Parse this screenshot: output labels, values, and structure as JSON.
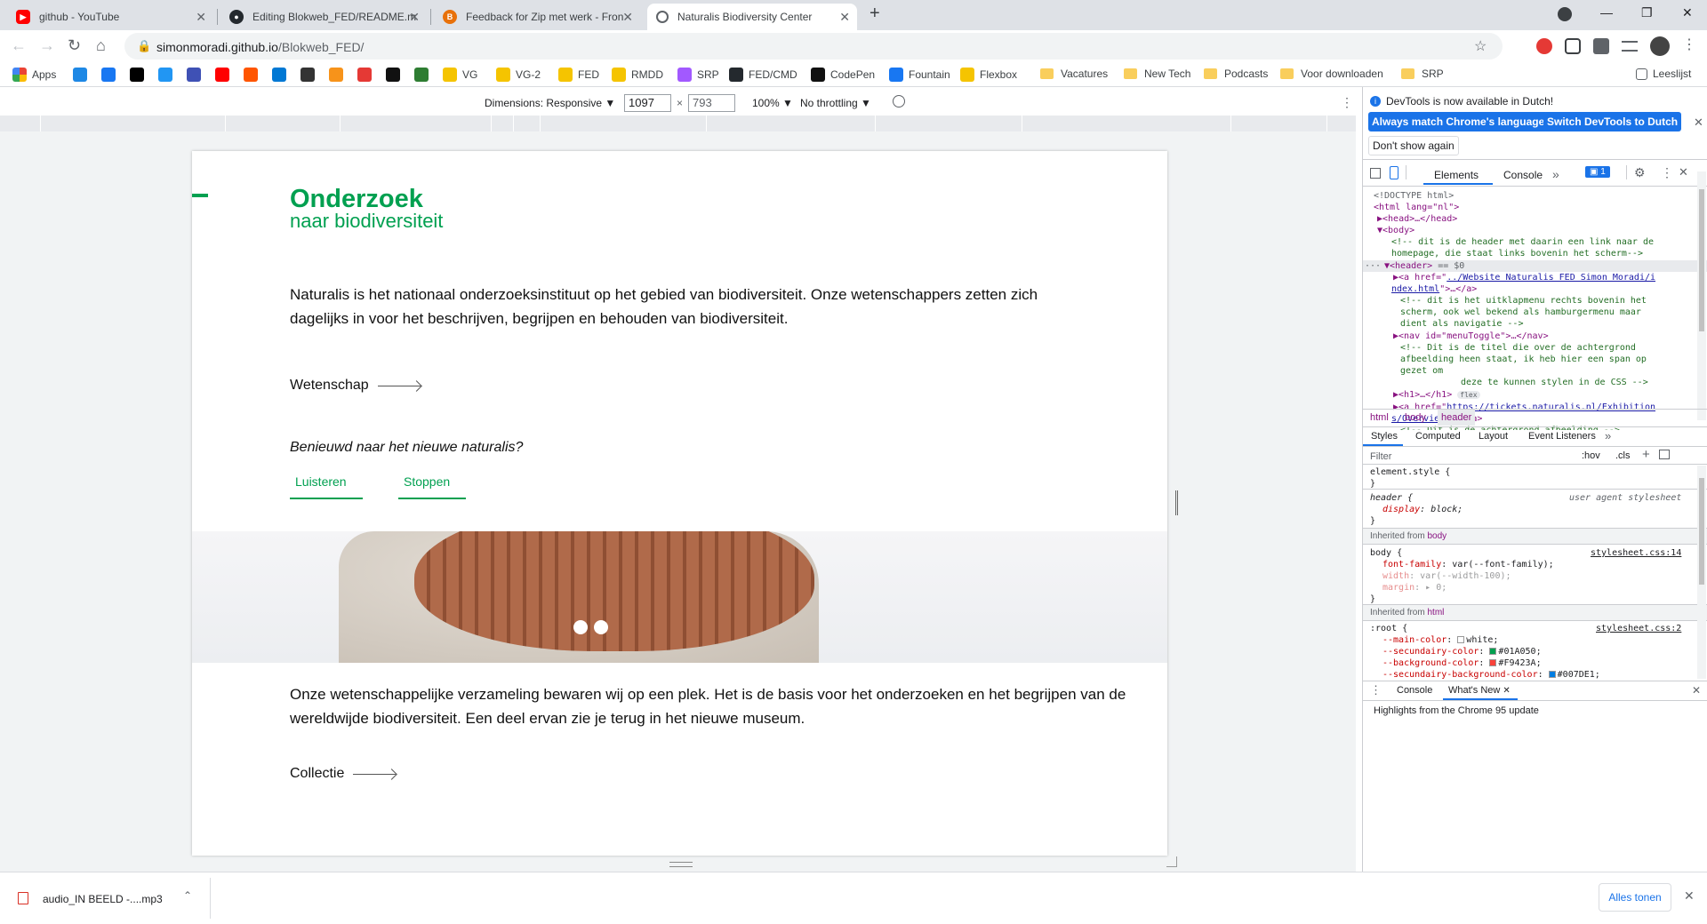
{
  "browser": {
    "tabs": [
      {
        "title": "github - YouTube",
        "icon": "youtube-icon",
        "color": "#ff0000"
      },
      {
        "title": "Editing Blokweb_FED/README.m",
        "icon": "github-icon",
        "color": "#24292e"
      },
      {
        "title": "Feedback for Zip met werk - Fron",
        "icon": "feedback-icon",
        "color": "#e8710a"
      },
      {
        "title": "Naturalis Biodiversity Center",
        "icon": "globe-icon",
        "color": "#5f6368"
      }
    ],
    "new_tab": "+",
    "url_host": "simonmoradi.github.io",
    "url_path": "/Blokweb_FED/",
    "bookmarks": [
      {
        "label": "Apps",
        "type": "apps"
      },
      {
        "label": "",
        "type": "icon",
        "color": "#1e88e5"
      },
      {
        "label": "",
        "type": "icon",
        "color": "#1877f2"
      },
      {
        "label": "",
        "type": "icon",
        "color": "#000000"
      },
      {
        "label": "",
        "type": "icon",
        "color": "#2196f3"
      },
      {
        "label": "",
        "type": "icon",
        "color": "#3f51b5"
      },
      {
        "label": "",
        "type": "icon",
        "color": "#ff0000"
      },
      {
        "label": "",
        "type": "icon",
        "color": "#ff5500"
      },
      {
        "label": "",
        "type": "icon",
        "color": "#0078d4"
      },
      {
        "label": "",
        "type": "icon",
        "color": "#333333"
      },
      {
        "label": "",
        "type": "icon",
        "color": "#f7931a"
      },
      {
        "label": "",
        "type": "icon",
        "color": "#e53935"
      },
      {
        "label": "",
        "type": "icon",
        "color": "#111111"
      },
      {
        "label": "",
        "type": "icon",
        "color": "#2e7d32"
      },
      {
        "label": "VG",
        "type": "icon",
        "color": "#f5c400"
      },
      {
        "label": "VG-2",
        "type": "icon",
        "color": "#f5c400"
      },
      {
        "label": "FED",
        "type": "icon",
        "color": "#f5c400"
      },
      {
        "label": "RMDD",
        "type": "icon",
        "color": "#f5c400"
      },
      {
        "label": "SRP",
        "type": "icon",
        "color": "#a259ff"
      },
      {
        "label": "FED/CMD",
        "type": "icon",
        "color": "#24292e"
      },
      {
        "label": "CodePen",
        "type": "icon",
        "color": "#111111"
      },
      {
        "label": "Fountain",
        "type": "icon",
        "color": "#1877f2"
      },
      {
        "label": "Flexbox",
        "type": "icon",
        "color": "#f5c400"
      },
      {
        "label": "Vacatures",
        "type": "folder"
      },
      {
        "label": "New Tech",
        "type": "folder"
      },
      {
        "label": "Podcasts",
        "type": "folder"
      },
      {
        "label": "Voor downloaden",
        "type": "folder"
      },
      {
        "label": "SRP",
        "type": "folder"
      }
    ],
    "reading_list": "Leeslijst"
  },
  "device_toolbar": {
    "dimensions_label": "Dimensions: Responsive ▼",
    "width": "1097",
    "times": "×",
    "height": "793",
    "zoom": "100% ▼",
    "throttle": "No throttling ▼"
  },
  "page": {
    "title_main": "Onderzoek",
    "title_sub": "naar biodiversiteit",
    "intro": "Naturalis is het nationaal onderzoeksinstituut op het gebied van biodiversiteit. Onze wetenschappers zetten zich dagelijks in voor het beschrijven, begrijpen en behouden van biodiversiteit.",
    "link_science": "Wetenschap",
    "curious": "Benieuwd naar het nieuwe naturalis?",
    "listen": "Luisteren",
    "stop": "Stoppen",
    "collection_text": "Onze wetenschappelijke verzameling bewaren wij op een plek. Het is de basis voor het onderzoeken en het begrijpen van de wereldwijde biodiversiteit. Een deel ervan zie je terug in het nieuwe museum.",
    "link_collection": "Collectie"
  },
  "devtools": {
    "info": "DevTools is now available in Dutch!",
    "btn_match": "Always match Chrome's language",
    "btn_switch": "Switch DevTools to Dutch",
    "btn_dont_show": "Don't show again",
    "tab_elements": "Elements",
    "tab_console": "Console",
    "tab_more": "»",
    "issues_count": "1",
    "dom": {
      "doctype": "<!DOCTYPE html>",
      "html_open": "<html lang=\"nl\">",
      "head": "▶<head>…</head>",
      "body_open": "▼<body>",
      "comment1a": "<!-- dit is de header met daarin een link naar de",
      "comment1b": "homepage, die staat links bovenin het scherm-->",
      "header_prefix": "···",
      "header_line": "▼<header>",
      "header_suffix": " == $0",
      "a_prefix": "▶<a href=\"",
      "a_link1": "../Website Naturalis FED Simon Moradi/i",
      "a_link1b": "ndex.html",
      "a_suffix": "\">…</a>",
      "comment2a": "<!-- dit is het uitklapmenu rechts bovenin het",
      "comment2b": "scherm, ook wel bekend als hamburgermenu maar",
      "comment2c": "dient als navigatie -->",
      "nav_line": "▶<nav id=\"menuToggle\">…</nav>",
      "comment3a": "<!-- Dit is de titel die over de achtergrond",
      "comment3b": "afbeelding heen staat, ik heb hier een span op",
      "comment3c": "gezet om",
      "comment3d": "deze te kunnen stylen in de CSS -->",
      "h1_line": "▶<h1>…</h1>",
      "flex_badge": "flex",
      "a2_prefix": "▶<a href=\"",
      "a2_link": "https://tickets.naturalis.nl/Exhibition",
      "a2_linkb": "s/Overview",
      "a2_suffix": "\">…</a>",
      "comment4": "<!-- Dit is de achtergrond afbeelding -->"
    },
    "breadcrumbs": [
      "html",
      "body",
      "header"
    ],
    "styles_tabs": [
      "Styles",
      "Computed",
      "Layout",
      "Event Listeners",
      "»"
    ],
    "filter_placeholder": "Filter",
    "hov": ":hov",
    "cls": ".cls",
    "styles": {
      "element_style": "element.style {",
      "close": "}",
      "header_sel": "header {",
      "ua": "user agent stylesheet",
      "display_prop": "display",
      "display_val": "block;",
      "inherited_body": "Inherited from",
      "body_tag": "body",
      "body_sel": "body {",
      "body_src": "stylesheet.css:14",
      "ff_prop": "font-family",
      "ff_val": "var(--font-family);",
      "w_prop": "width",
      "w_val": "var(--width-100);",
      "m_prop": "margin",
      "m_val": "▸ 0;",
      "inherited_html": "Inherited from",
      "html_tag": "html",
      "root_sel": ":root {",
      "root_src": "stylesheet.css:2",
      "v1_prop": "--main-color",
      "v1_val": "white;",
      "v1_color": "#ffffff",
      "v2_prop": "--secundairy-color",
      "v2_val": "#01A050;",
      "v2_color": "#01A050",
      "v3_prop": "--background-color",
      "v3_val": "#F9423A;",
      "v3_color": "#F9423A",
      "v4_prop": "--secundairy-background-color",
      "v4_val": "#007DE1;",
      "v4_color": "#007DE1"
    },
    "drawer_console": "Console",
    "drawer_whatsnew": "What's New",
    "whatsnew_text": "Highlights from the Chrome 95 update"
  },
  "downloads": {
    "file": "audio_IN BEELD -....mp3",
    "show_all": "Alles tonen"
  }
}
